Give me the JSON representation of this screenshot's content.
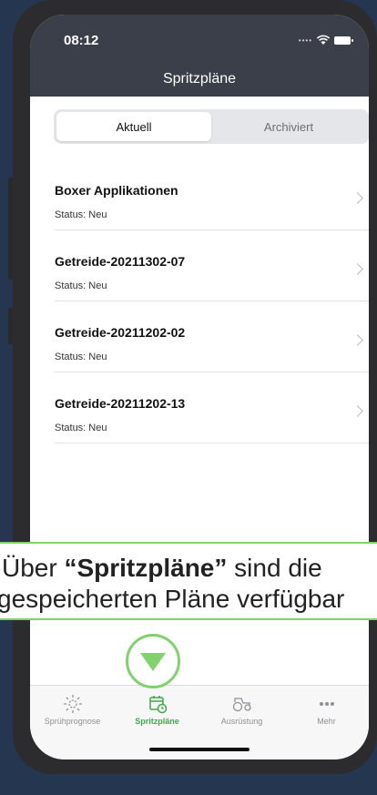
{
  "status_bar": {
    "time": "08:12"
  },
  "nav": {
    "title": "Spritzpläne"
  },
  "segments": {
    "active": "Aktuell",
    "inactive": "Archiviert"
  },
  "plans": [
    {
      "title": "Boxer Applikationen",
      "status": "Status: Neu"
    },
    {
      "title": "Getreide-20211302-07",
      "status": "Status: Neu"
    },
    {
      "title": "Getreide-20211202-02",
      "status": "Status: Neu"
    },
    {
      "title": "Getreide-20211202-13",
      "status": "Status: Neu"
    }
  ],
  "tooltip": {
    "prefix": "Über ",
    "highlight": "“Spritzpläne”",
    "suffix": " sind die",
    "line2": "gespeicherten Pläne verfügbar"
  },
  "tabs": [
    {
      "label": "Sprühprognose",
      "icon": "sun-icon"
    },
    {
      "label": "Spritzpläne",
      "icon": "calendar-clock-icon",
      "active": true
    },
    {
      "label": "Ausrüstung",
      "icon": "tractor-icon"
    },
    {
      "label": "Mehr",
      "icon": "more-dots-icon"
    }
  ],
  "colors": {
    "accent": "#7fd36a",
    "tab_active": "#3fa84b",
    "nav_bg": "#3a3f4a",
    "background": "#243650"
  }
}
